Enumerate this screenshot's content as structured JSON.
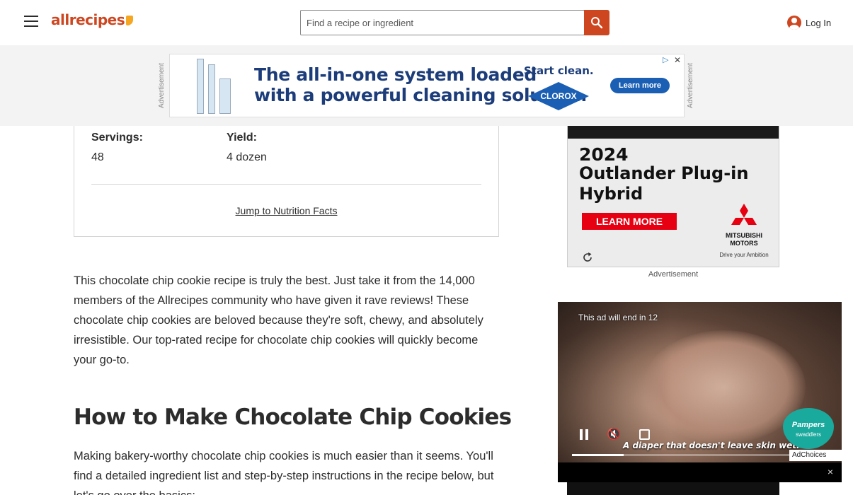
{
  "header": {
    "logo_text": "allrecipes",
    "search_placeholder": "Find a recipe or ingredient",
    "login_label": "Log In"
  },
  "top_ad": {
    "vertical_label": "Advertisement",
    "headline_line1": "The all-in-one system loaded",
    "headline_line2": "with a powerful cleaning solution.",
    "start_clean": "Start clean.",
    "brand": "CLOROX",
    "cta": "Learn more"
  },
  "recipe_meta": {
    "servings_label": "Servings:",
    "servings_value": "48",
    "yield_label": "Yield:",
    "yield_value": "4 dozen",
    "nutrition_link": "Jump to Nutrition Facts"
  },
  "article": {
    "intro": "This chocolate chip cookie recipe is truly the best. Just take it from the 14,000 members of the Allrecipes community who have given it rave reviews! These chocolate chip cookies are beloved because they're soft, chewy, and absolutely irresistible. Our top-rated recipe for chocolate chip cookies will quickly become your go-to.",
    "heading": "How to Make Chocolate Chip Cookies",
    "body": "Making bakery-worthy chocolate chip cookies is much easier than it seems. You'll find a detailed ingredient list and step-by-step instructions in the recipe below, but let's go over the basics:"
  },
  "car_ad": {
    "year": "2024",
    "model": "Outlander Plug-in Hybrid",
    "cta": "LEARN MORE",
    "brand_line1": "MITSUBISHI",
    "brand_line2": "MOTORS",
    "brand_tag": "Drive your Ambition",
    "label": "Advertisement"
  },
  "video_ad": {
    "countdown": "This ad will end in 12",
    "tagline": "A diaper that doesn't leave skin wet.",
    "brand": "Pampers",
    "brand_sub": "swaddlers",
    "adchoices": "AdChoices",
    "progress": 0.2,
    "close": "×"
  },
  "colors": {
    "brand": "#ce4620",
    "clorox_blue": "#1b5fb4",
    "mitsubishi_red": "#e60012",
    "pampers_teal": "#1aa99d"
  }
}
